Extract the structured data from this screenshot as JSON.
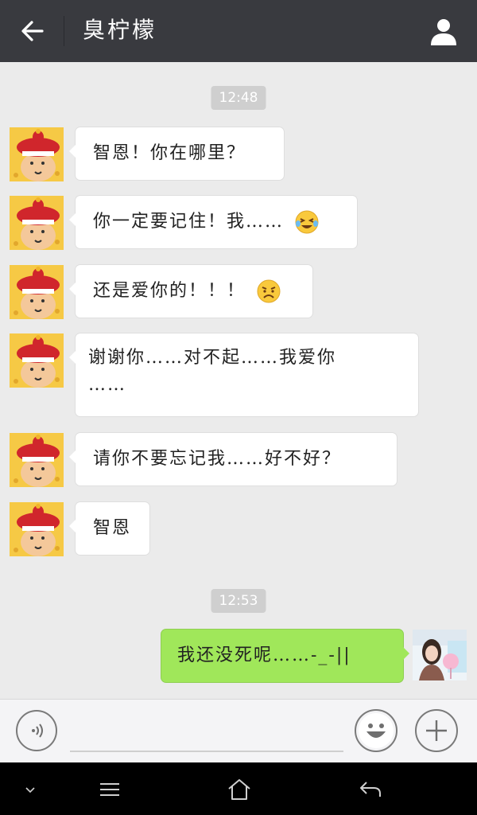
{
  "header": {
    "title": "臭柠檬"
  },
  "timestamps": [
    "12:48",
    "12:53"
  ],
  "messages": [
    {
      "sender": "contact",
      "text": "智恩！你在哪里？"
    },
    {
      "sender": "contact",
      "text": "你一定要记住！我……",
      "emoji": "crying-laughing-emoji"
    },
    {
      "sender": "contact",
      "text": "还是爱你的！！！",
      "emoji": "sad-emoji"
    },
    {
      "sender": "contact",
      "line1": "谢谢你……对不起……我爱你",
      "line2": "……"
    },
    {
      "sender": "contact",
      "text": "请你不要忘记我……好不好？"
    },
    {
      "sender": "contact",
      "text": "智恩"
    },
    {
      "sender": "me",
      "text": "我还没死呢……-_-||"
    }
  ],
  "input": {
    "value": "",
    "placeholder": ""
  },
  "colors": {
    "header_bg": "#393a3f",
    "chat_bg": "#ebebeb",
    "my_bubble": "#a0e75a",
    "their_bubble": "#ffffff"
  },
  "icons": {
    "back": "arrow-left-icon",
    "profile": "person-icon",
    "voice": "voice-icon",
    "emoji": "smiley-icon",
    "plus": "plus-icon",
    "nav_menu": "menu-icon",
    "nav_home": "home-icon",
    "nav_back": "return-icon",
    "nav_down": "chevron-down-icon"
  }
}
